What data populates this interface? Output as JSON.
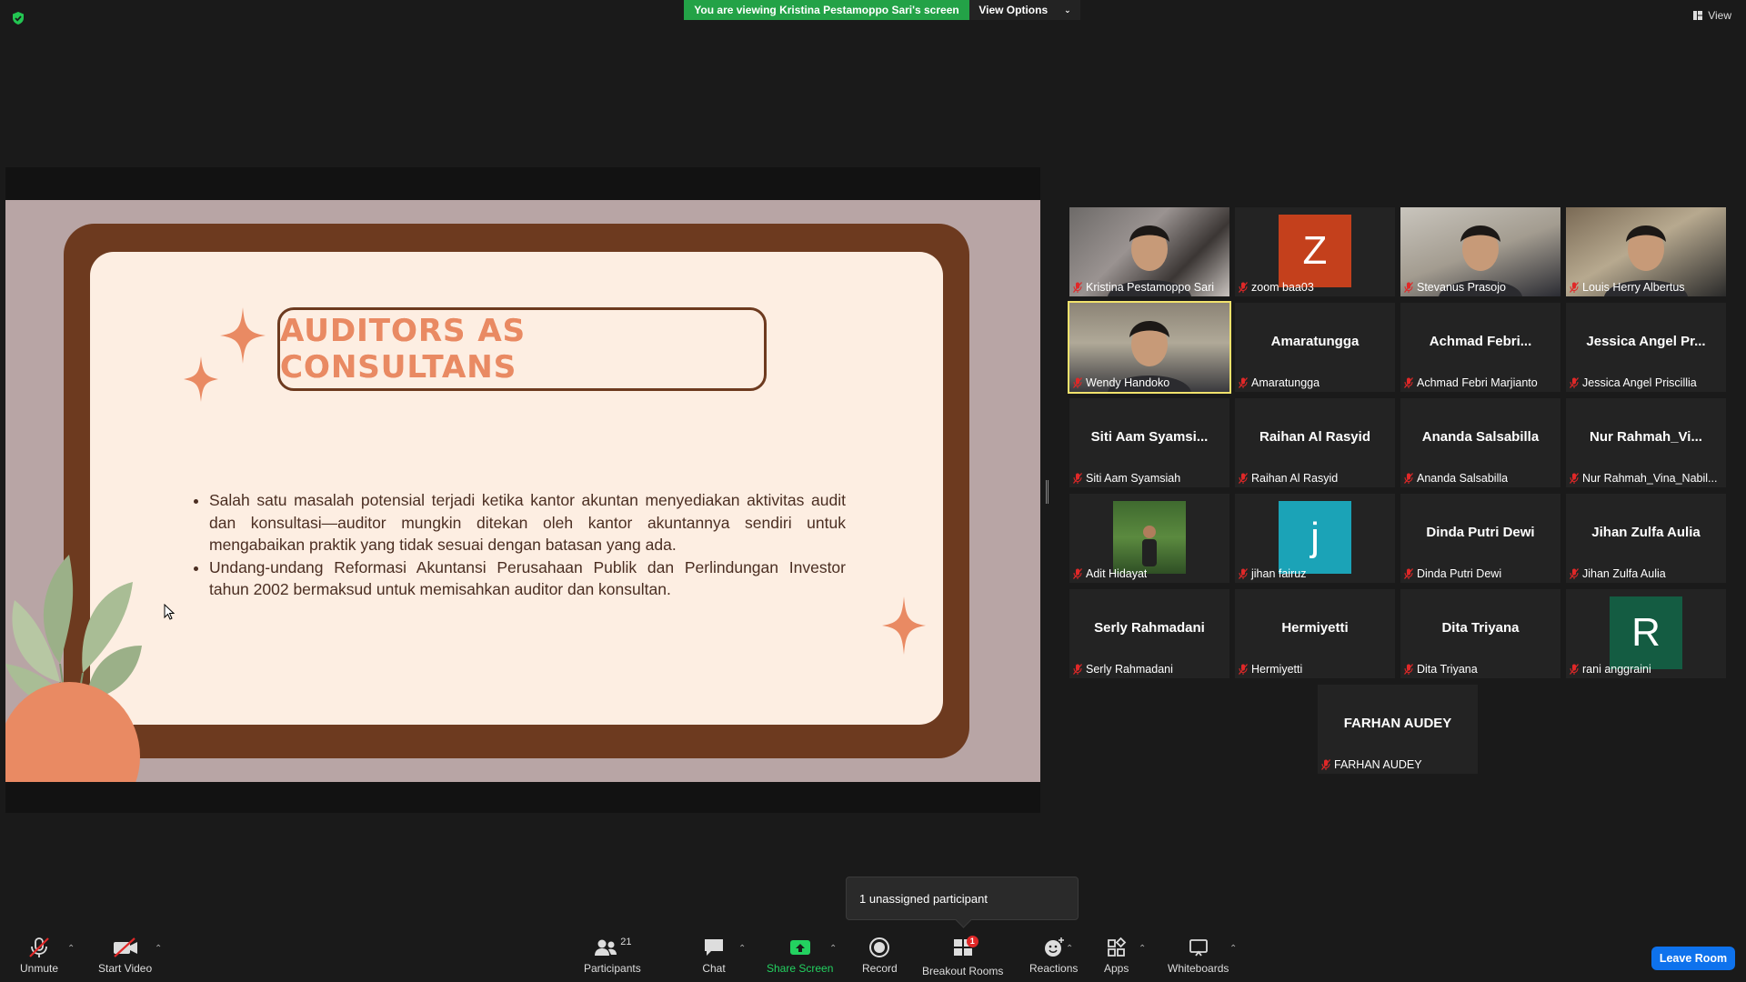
{
  "banner": {
    "viewing_text": "You are viewing Kristina Pestamoppo Sari's screen",
    "view_options_label": "View Options",
    "view_label": "View"
  },
  "slide": {
    "title": "AUDITORS AS CONSULTANS",
    "bullets": [
      "Salah satu masalah potensial terjadi ketika kantor akuntan menyediakan aktivitas audit dan konsultasi—auditor mungkin ditekan oleh kantor akuntannya sendiri untuk mengabaikan praktik yang tidak sesuai dengan batasan yang ada.",
      "Undang-undang Reformasi Akuntansi Perusahaan Publik dan Perlindungan Investor tahun 2002 bermaksud untuk memisahkan auditor dan konsultan."
    ]
  },
  "participants": [
    {
      "label": "Kristina Pestamoppo Sari",
      "big": "",
      "type": "video"
    },
    {
      "label": "zoom baa03",
      "big": "Z",
      "type": "avatar",
      "color": "#c4401c"
    },
    {
      "label": "Stevanus Prasojo",
      "big": "",
      "type": "video"
    },
    {
      "label": "Louis Herry Albertus",
      "big": "",
      "type": "video"
    },
    {
      "label": "Wendy Handoko",
      "big": "",
      "type": "video",
      "active": true
    },
    {
      "label": "Amaratungga",
      "big": "Amaratungga",
      "type": "name"
    },
    {
      "label": "Achmad Febri Marjianto",
      "big": "Achmad Febri...",
      "type": "name"
    },
    {
      "label": "Jessica Angel Priscillia",
      "big": "Jessica Angel Pr...",
      "type": "name"
    },
    {
      "label": "Siti Aam Syamsiah",
      "big": "Siti Aam Syamsi...",
      "type": "name"
    },
    {
      "label": "Raihan Al Rasyid",
      "big": "Raihan Al Rasyid",
      "type": "name"
    },
    {
      "label": "Ananda Salsabilla",
      "big": "Ananda Salsabilla",
      "type": "name"
    },
    {
      "label": "Nur Rahmah_Vina_Nabil...",
      "big": "Nur Rahmah_Vi...",
      "type": "name"
    },
    {
      "label": "Adit Hidayat",
      "big": "",
      "type": "photo"
    },
    {
      "label": "jihan fairuz",
      "big": "j",
      "type": "avatar",
      "color": "#1ba3b7"
    },
    {
      "label": "Dinda Putri Dewi",
      "big": "Dinda Putri Dewi",
      "type": "name"
    },
    {
      "label": "Jihan Zulfa Aulia",
      "big": "Jihan Zulfa Aulia",
      "type": "name"
    },
    {
      "label": "Serly Rahmadani",
      "big": "Serly Rahmadani",
      "type": "name"
    },
    {
      "label": "Hermiyetti",
      "big": "Hermiyetti",
      "type": "name"
    },
    {
      "label": "Dita Triyana",
      "big": "Dita Triyana",
      "type": "name"
    },
    {
      "label": "rani anggraini",
      "big": "R",
      "type": "avatar",
      "color": "#145c42"
    },
    {
      "label": "FARHAN AUDEY",
      "big": "FARHAN AUDEY",
      "type": "name"
    }
  ],
  "tooltip": {
    "text": "1 unassigned participant"
  },
  "toolbar": {
    "unmute": "Unmute",
    "start_video": "Start Video",
    "participants": "Participants",
    "participants_count": "21",
    "chat": "Chat",
    "share_screen": "Share Screen",
    "record": "Record",
    "breakout_rooms": "Breakout Rooms",
    "breakout_badge": "1",
    "reactions": "Reactions",
    "apps": "Apps",
    "whiteboards": "Whiteboards",
    "leave_room": "Leave Room"
  },
  "colors": {
    "banner_green": "#23a247",
    "slide_brown": "#6d3a1f",
    "slide_cream": "#fdeee2",
    "slide_accent": "#e98a63",
    "leave_blue": "#0e72ed"
  }
}
